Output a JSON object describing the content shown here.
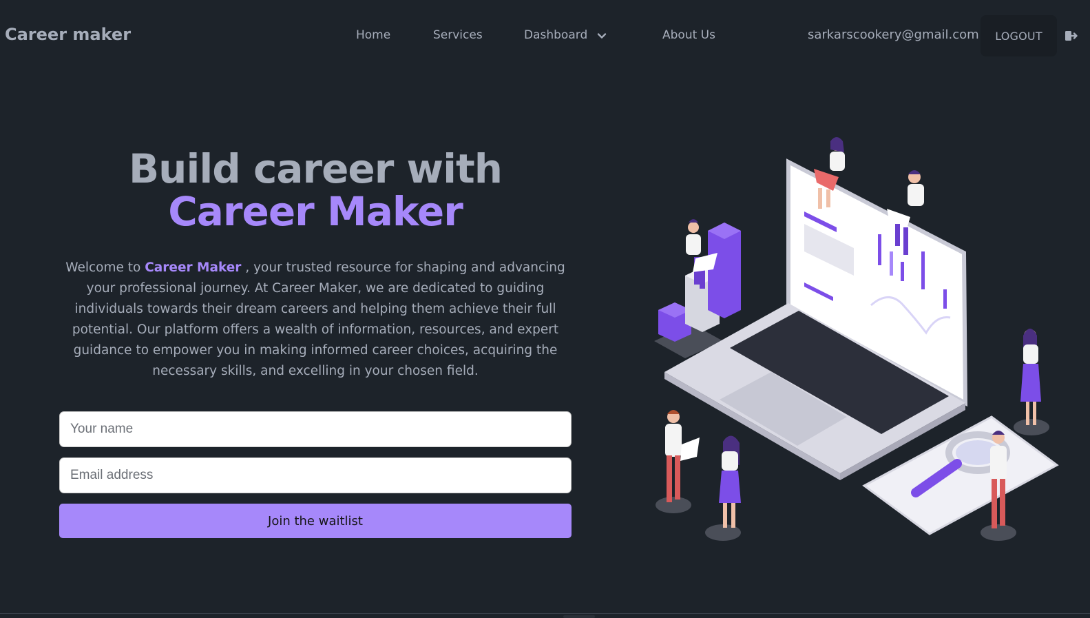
{
  "navbar": {
    "brand": "Career maker",
    "links": {
      "home": "Home",
      "services": "Services",
      "dashboard": "Dashboard",
      "about": "About Us"
    },
    "dashboard_icon": "chevron-down-icon",
    "user_email": "sarkarscookery@gmail.com",
    "logout_label": "LOGOUT",
    "logout_icon": "logout-icon"
  },
  "hero": {
    "headline_line1": "Build career with",
    "headline_line2": "Career Maker",
    "description_prefix": "Welcome to ",
    "description_highlight": "Career Maker",
    "description_suffix": " , your trusted resource for shaping and advancing your professional journey. At Career Maker, we are dedicated to guiding individuals towards their dream careers and helping them achieve their full potential. Our platform offers a wealth of information, resources, and expert guidance to empower you in making informed career choices, acquiring the necessary skills, and excelling in your chosen field.",
    "form": {
      "name_placeholder": "Your name",
      "email_placeholder": "Email address",
      "submit_label": "Join the waitlist"
    }
  },
  "colors": {
    "background": "#1d232a",
    "text": "#a6adba",
    "accent": "#a688fa",
    "logout_bg": "#191e24"
  }
}
